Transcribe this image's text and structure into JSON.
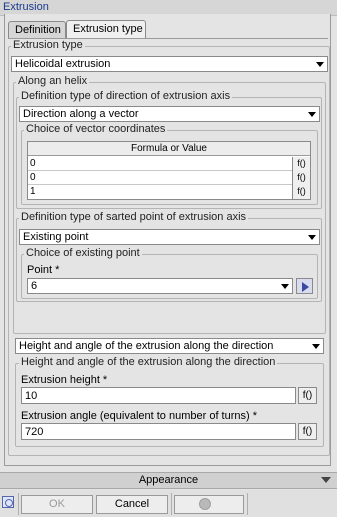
{
  "window": {
    "title": "Extrusion"
  },
  "tabs": [
    {
      "label": "Definition"
    },
    {
      "label": "Extrusion type"
    }
  ],
  "extrusion_type": {
    "group_label": "Extrusion type",
    "selected": "Helicoidal extrusion"
  },
  "helix": {
    "group_label": "Along an helix",
    "direction_type": {
      "group_label": "Definition type of direction of extrusion axis",
      "selected": "Direction along a vector"
    },
    "vector": {
      "group_label": "Choice of vector coordinates",
      "column_header": "Formula or Value",
      "rows": [
        "0",
        "0",
        "1"
      ],
      "formula_button": "f()"
    },
    "start_point_type": {
      "group_label": "Definition type of sarted point of extrusion axis",
      "selected": "Existing point"
    },
    "existing_point": {
      "group_label": "Choice of existing point",
      "field_label": "Point *",
      "selected": "6"
    }
  },
  "height_angle": {
    "selected": "Height and angle of the extrusion along the direction",
    "group_label": "Height and angle of the extrusion along the direction",
    "height_label": "Extrusion height *",
    "height_value": "10",
    "angle_label": "Extrusion angle (equivalent to number of turns) *",
    "angle_value": "720",
    "formula_button": "f()"
  },
  "appearance": {
    "label": "Appearance"
  },
  "buttons": {
    "ok": "OK",
    "cancel": "Cancel"
  }
}
